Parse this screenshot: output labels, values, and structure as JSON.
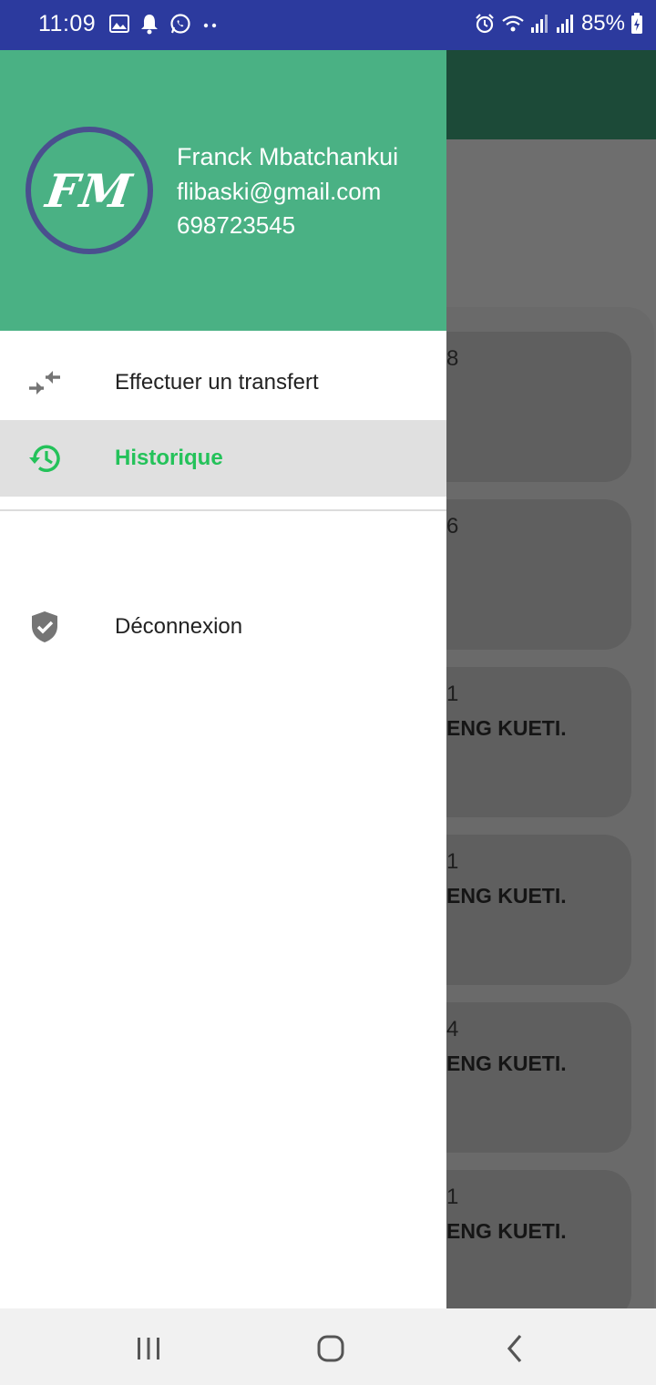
{
  "status_bar": {
    "time": "11:09",
    "battery": "85%",
    "left_icons": [
      "image-icon",
      "notification-bell-icon",
      "whatsapp-icon",
      "more-dots-icon"
    ],
    "right_icons": [
      "alarm-icon",
      "wifi-icon",
      "signal-icon",
      "signal-icon",
      "battery-charging-icon"
    ],
    "background_color": "#2c3a9e"
  },
  "drawer": {
    "header_color": "#4ab184",
    "avatar_initials": "FM",
    "user": {
      "name": "Franck Mbatchankui",
      "email": "flibaski@gmail.com",
      "phone": "698723545"
    },
    "menu": [
      {
        "label": "Effectuer un transfert",
        "icon": "transfer-arrows-icon",
        "active": false
      },
      {
        "label": "Historique",
        "icon": "history-icon",
        "active": true
      },
      {
        "label": "Déconnexion",
        "icon": "shield-check-icon",
        "active": false
      }
    ],
    "active_color": "#24c25a"
  },
  "background_app": {
    "cards": [
      {
        "number_fragment": "8",
        "name_fragment": ""
      },
      {
        "number_fragment": "6",
        "name_fragment": ""
      },
      {
        "number_fragment": "1",
        "name_fragment": "ENG KUETI."
      },
      {
        "number_fragment": "1",
        "name_fragment": "ENG KUETI."
      },
      {
        "number_fragment": "4",
        "name_fragment": "ENG KUETI."
      },
      {
        "number_fragment": "1",
        "name_fragment": "ENG KUETI."
      }
    ]
  },
  "nav_bar": {
    "buttons": [
      "recent-apps-icon",
      "home-icon",
      "back-icon"
    ]
  }
}
